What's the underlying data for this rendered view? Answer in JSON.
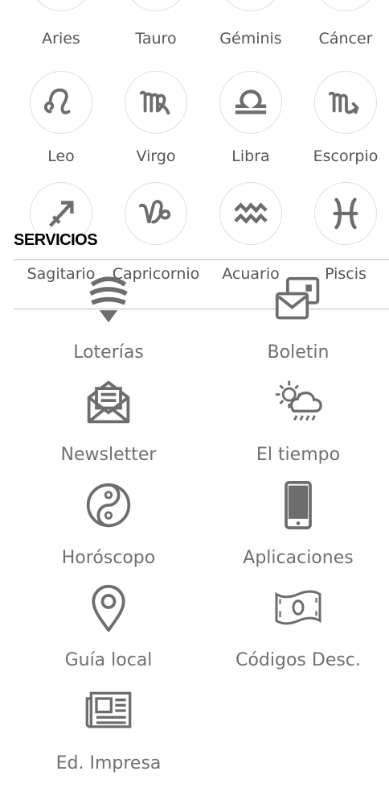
{
  "zodiac": {
    "row1": [
      "Aries",
      "Tauro",
      "Géminis",
      "Cáncer"
    ],
    "row2": [
      "Leo",
      "Virgo",
      "Libra",
      "Escorpio"
    ],
    "row3": [
      "Sagitario",
      "Capricornio",
      "Acuario",
      "Piscis"
    ]
  },
  "services": {
    "title": "SERVICIOS",
    "items": [
      {
        "label": "Loterías",
        "icon": "lottery-icon"
      },
      {
        "label": "Boletin",
        "icon": "bulletin-icon"
      },
      {
        "label": "Newsletter",
        "icon": "newsletter-icon"
      },
      {
        "label": "El tiempo",
        "icon": "weather-icon"
      },
      {
        "label": "Horóscopo",
        "icon": "yin-yang-icon"
      },
      {
        "label": "Aplicaciones",
        "icon": "phone-icon"
      },
      {
        "label": "Guía local",
        "icon": "location-pin-icon"
      },
      {
        "label": "Códigos Desc.",
        "icon": "banknote-icon"
      },
      {
        "label": "Ed. Impresa",
        "icon": "newspaper-icon"
      }
    ]
  },
  "colors": {
    "icon": "#6d6d6d",
    "circle_border": "#dedede",
    "label": "#707070"
  }
}
